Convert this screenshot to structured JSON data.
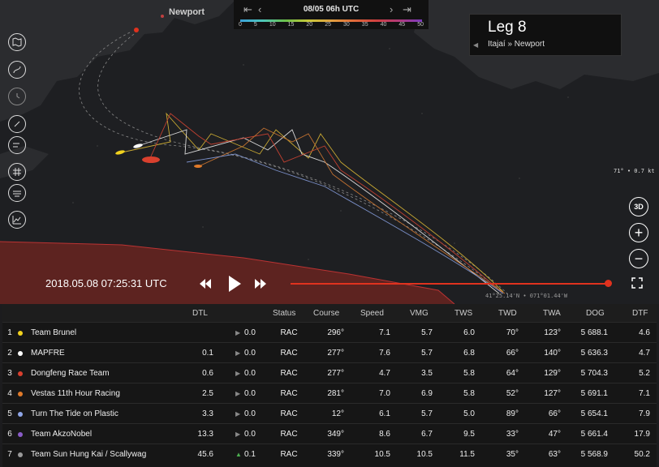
{
  "map": {
    "place_label": "Newport",
    "wind_readout": "71° • 0.7 kt",
    "cursor_coords": "41°25.14'N • 071°01.44'W"
  },
  "timebar": {
    "date": "08/05 06h UTC",
    "scale_ticks": [
      "0",
      "5",
      "10",
      "15",
      "20",
      "25",
      "30",
      "35",
      "40",
      "45",
      "50"
    ]
  },
  "leg": {
    "title": "Leg 8",
    "route": "Itajaí » Newport"
  },
  "playback": {
    "timestamp": "2018.05.08 07:25:31 UTC",
    "progress_fraction": 0.99
  },
  "table": {
    "headers": {
      "dtl": "DTL",
      "status": "Status",
      "course": "Course",
      "speed": "Speed",
      "vmg": "VMG",
      "tws": "TWS",
      "twd": "TWD",
      "twa": "TWA",
      "dog": "DOG",
      "dtf": "DTF"
    },
    "rows": [
      {
        "rank": "1",
        "color": "#f2d21e",
        "team": "Team Brunel",
        "dtl": "",
        "delta": "0.0",
        "trend": "flat",
        "status": "RAC",
        "course": "296°",
        "speed": "7.1",
        "vmg": "5.7",
        "tws": "6.0",
        "twd": "70°",
        "twa": "123°",
        "dog": "5 688.1",
        "dtf": "4.6"
      },
      {
        "rank": "2",
        "color": "#ffffff",
        "team": "MAPFRE",
        "dtl": "0.1",
        "delta": "0.0",
        "trend": "flat",
        "status": "RAC",
        "course": "277°",
        "speed": "7.6",
        "vmg": "5.7",
        "tws": "6.8",
        "twd": "66°",
        "twa": "140°",
        "dog": "5 636.3",
        "dtf": "4.7"
      },
      {
        "rank": "3",
        "color": "#d9402e",
        "team": "Dongfeng Race Team",
        "dtl": "0.6",
        "delta": "0.0",
        "trend": "flat",
        "status": "RAC",
        "course": "277°",
        "speed": "4.7",
        "vmg": "3.5",
        "tws": "5.8",
        "twd": "64°",
        "twa": "129°",
        "dog": "5 704.3",
        "dtf": "5.2"
      },
      {
        "rank": "4",
        "color": "#e07a2a",
        "team": "Vestas 11th Hour Racing",
        "dtl": "2.5",
        "delta": "0.0",
        "trend": "flat",
        "status": "RAC",
        "course": "281°",
        "speed": "7.0",
        "vmg": "6.9",
        "tws": "5.8",
        "twd": "52°",
        "twa": "127°",
        "dog": "5 691.1",
        "dtf": "7.1"
      },
      {
        "rank": "5",
        "color": "#8fa6e8",
        "team": "Turn The Tide on Plastic",
        "dtl": "3.3",
        "delta": "0.0",
        "trend": "flat",
        "status": "RAC",
        "course": "12°",
        "speed": "6.1",
        "vmg": "5.7",
        "tws": "5.0",
        "twd": "89°",
        "twa": "66°",
        "dog": "5 654.1",
        "dtf": "7.9"
      },
      {
        "rank": "6",
        "color": "#8a5cc8",
        "team": "Team AkzoNobel",
        "dtl": "13.3",
        "delta": "0.0",
        "trend": "flat",
        "status": "RAC",
        "course": "349°",
        "speed": "8.6",
        "vmg": "6.7",
        "tws": "9.5",
        "twd": "33°",
        "twa": "47°",
        "dog": "5 661.4",
        "dtf": "17.9"
      },
      {
        "rank": "7",
        "color": "#9a9a9a",
        "team": "Team Sun Hung Kai / Scallywag",
        "dtl": "45.6",
        "delta": "0.1",
        "trend": "up",
        "status": "RAC",
        "course": "339°",
        "speed": "10.5",
        "vmg": "10.5",
        "tws": "11.5",
        "twd": "35°",
        "twa": "63°",
        "dog": "5 568.9",
        "dtf": "50.2"
      }
    ]
  }
}
